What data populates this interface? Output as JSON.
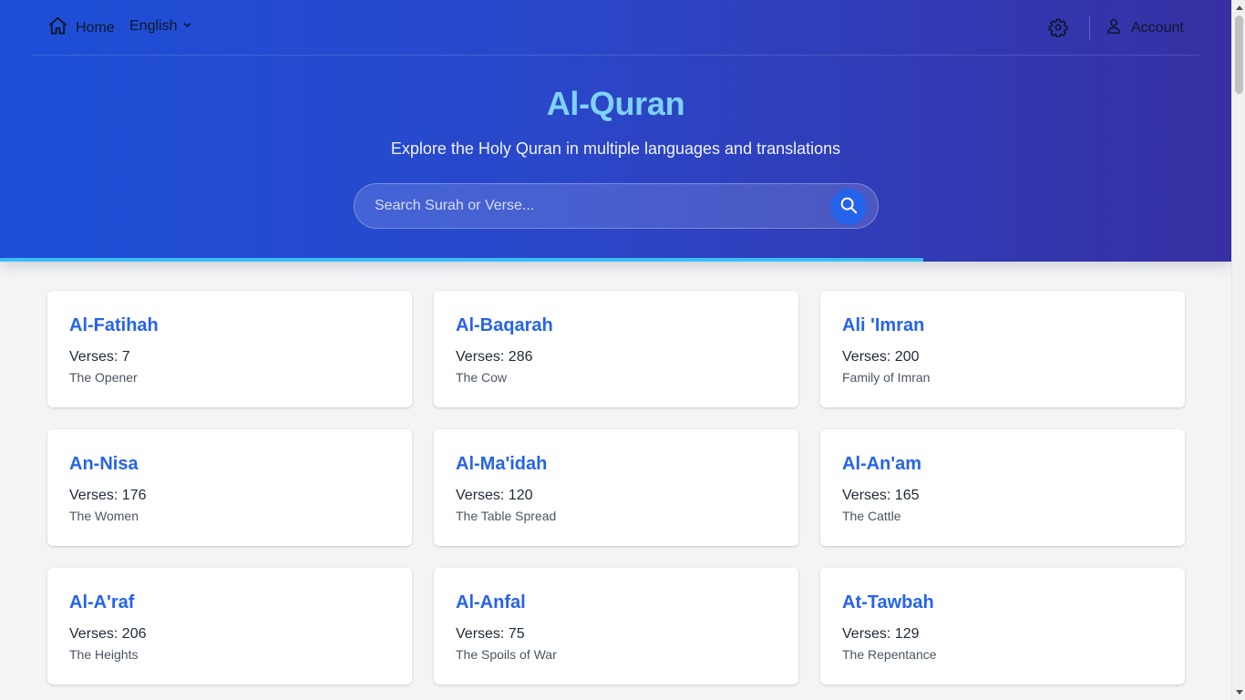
{
  "nav": {
    "home_label": "Home",
    "language_label": "English",
    "account_label": "Account"
  },
  "hero": {
    "title": "Al-Quran",
    "subtitle": "Explore the Holy Quran in multiple languages and translations",
    "search_placeholder": "Search Surah or Verse..."
  },
  "progress": {
    "fraction": 0.75,
    "color": "#38bdf8"
  },
  "surahs": [
    {
      "name": "Al-Fatihah",
      "verses": "Verses: 7",
      "meaning": "The Opener"
    },
    {
      "name": "Al-Baqarah",
      "verses": "Verses: 286",
      "meaning": "The Cow"
    },
    {
      "name": "Ali 'Imran",
      "verses": "Verses: 200",
      "meaning": "Family of Imran"
    },
    {
      "name": "An-Nisa",
      "verses": "Verses: 176",
      "meaning": "The Women"
    },
    {
      "name": "Al-Ma'idah",
      "verses": "Verses: 120",
      "meaning": "The Table Spread"
    },
    {
      "name": "Al-An'am",
      "verses": "Verses: 165",
      "meaning": "The Cattle"
    },
    {
      "name": "Al-A'raf",
      "verses": "Verses: 206",
      "meaning": "The Heights"
    },
    {
      "name": "Al-Anfal",
      "verses": "Verses: 75",
      "meaning": "The Spoils of War"
    },
    {
      "name": "At-Tawbah",
      "verses": "Verses: 129",
      "meaning": "The Repentance"
    }
  ],
  "colors": {
    "header_gradient_start": "#1d4fd8",
    "header_gradient_end": "#3730a3",
    "title": "#7dd3fc",
    "card_title": "#2563eb",
    "search_button": "#2563eb"
  },
  "icons": {
    "home": "home-icon",
    "language_dropdown": "chevron-down-icon",
    "settings": "gear-icon",
    "account": "user-icon",
    "search": "search-icon"
  }
}
